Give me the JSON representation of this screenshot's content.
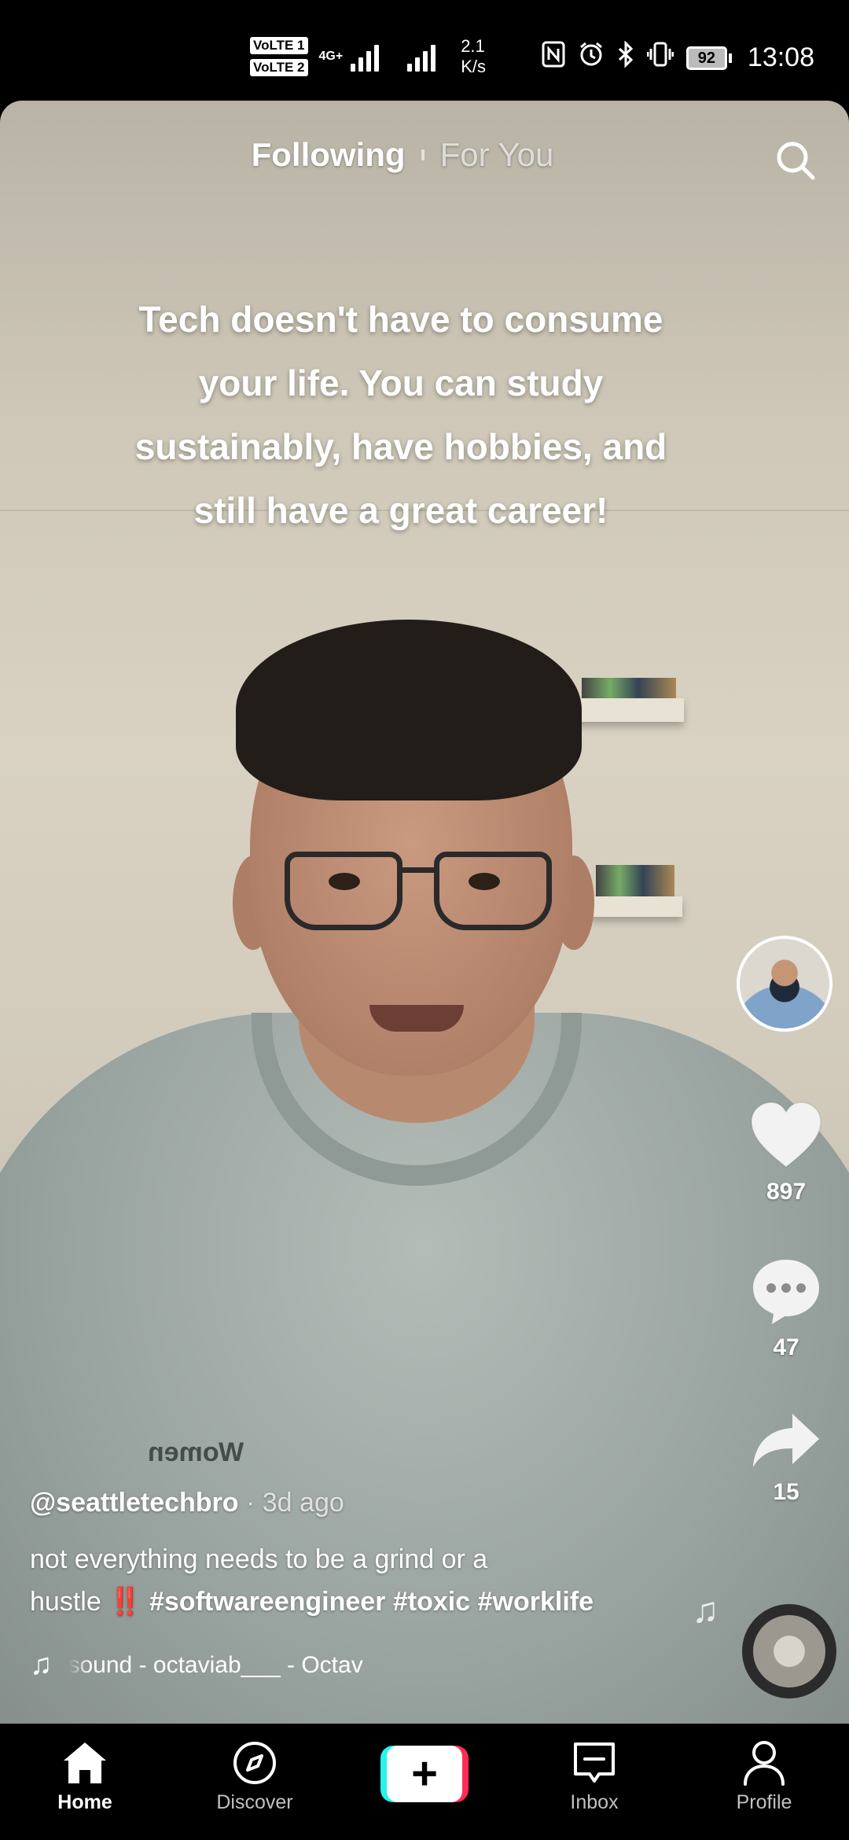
{
  "status_bar": {
    "sim1": "VoLTE 1",
    "sim2": "VoLTE 2",
    "network": "4G+",
    "speed_value": "2.1",
    "speed_unit": "K/s",
    "icons": [
      "nfc-icon",
      "alarm-icon",
      "bluetooth-icon",
      "vibrate-icon"
    ],
    "battery": "92",
    "time": "13:08"
  },
  "top_tabs": {
    "following": "Following",
    "for_you": "For You",
    "active": "following"
  },
  "video": {
    "overlay_lines": [
      "Tech doesn't have to consume",
      "your life. You can study",
      "sustainably, have hobbies, and",
      "still have a great career!"
    ],
    "shirt_print": "Women"
  },
  "rail": {
    "likes": "897",
    "comments": "47",
    "shares": "15"
  },
  "post": {
    "author": "@seattletechbro",
    "time": " · 3d ago",
    "desc_line1": "not everything needs to be a grind or a",
    "desc_line2_text": "hustle",
    "desc_emoji": "‼️",
    "hashtags": [
      "#softwareengineer",
      "#toxic",
      "#worklife"
    ],
    "sound": "sound - octaviab___ - Octav"
  },
  "nav": {
    "home": "Home",
    "discover": "Discover",
    "create": "+",
    "inbox": "Inbox",
    "profile": "Profile",
    "active": "home"
  },
  "colors": {
    "accent_red": "#fe2c55",
    "accent_cyan": "#25f4ee",
    "emoji_red": "#e0262d"
  }
}
